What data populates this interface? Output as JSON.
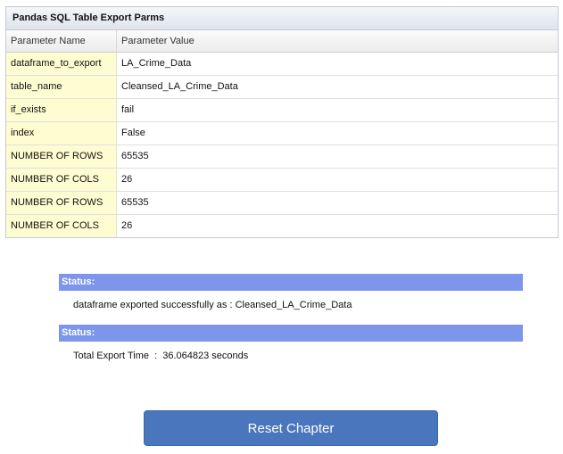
{
  "table": {
    "title": "Pandas SQL Table Export Parms",
    "headers": [
      "Parameter Name",
      "Parameter Value"
    ],
    "rows": [
      {
        "name": "dataframe_to_export",
        "value": "LA_Crime_Data"
      },
      {
        "name": "table_name",
        "value": "Cleansed_LA_Crime_Data"
      },
      {
        "name": "if_exists",
        "value": "fail"
      },
      {
        "name": "index",
        "value": "False"
      },
      {
        "name": "NUMBER OF ROWS",
        "value": "65535"
      },
      {
        "name": "NUMBER OF COLS",
        "value": "26"
      },
      {
        "name": "NUMBER OF ROWS",
        "value": "65535"
      },
      {
        "name": "NUMBER OF COLS",
        "value": "26"
      }
    ]
  },
  "status": [
    {
      "label": "Status:",
      "message": "dataframe exported successfully as : Cleansed_LA_Crime_Data"
    },
    {
      "label": "Status:",
      "message": "Total Export Time  :  36.064823 seconds"
    }
  ],
  "reset_button": {
    "label": "Reset Chapter"
  },
  "colors": {
    "status_bar": "#7d96eb",
    "name_cell": "#fefdd2",
    "button": "#4a76bd"
  }
}
